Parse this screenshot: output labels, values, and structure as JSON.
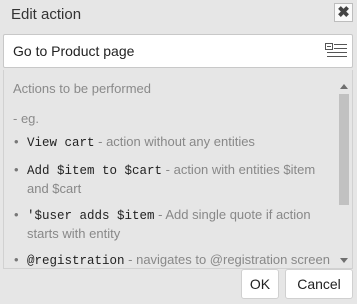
{
  "dialog": {
    "title": "Edit action",
    "close_label": "✖"
  },
  "name_field": {
    "value": "Go to Product page",
    "icon": "list-icon"
  },
  "help": {
    "heading": "Actions to be performed",
    "eg": "- eg.",
    "bullet": "•",
    "items": [
      {
        "code": "View cart",
        "desc": " - action without any entities"
      },
      {
        "code": "Add $item to $cart",
        "desc": " - action with entities $item and $cart"
      },
      {
        "code": "'$user adds $item",
        "desc": " - Add single quote if action starts with entity"
      },
      {
        "code": "@registration",
        "desc": " - navigates to @registration screen"
      }
    ]
  },
  "buttons": {
    "ok": "OK",
    "cancel": "Cancel"
  }
}
